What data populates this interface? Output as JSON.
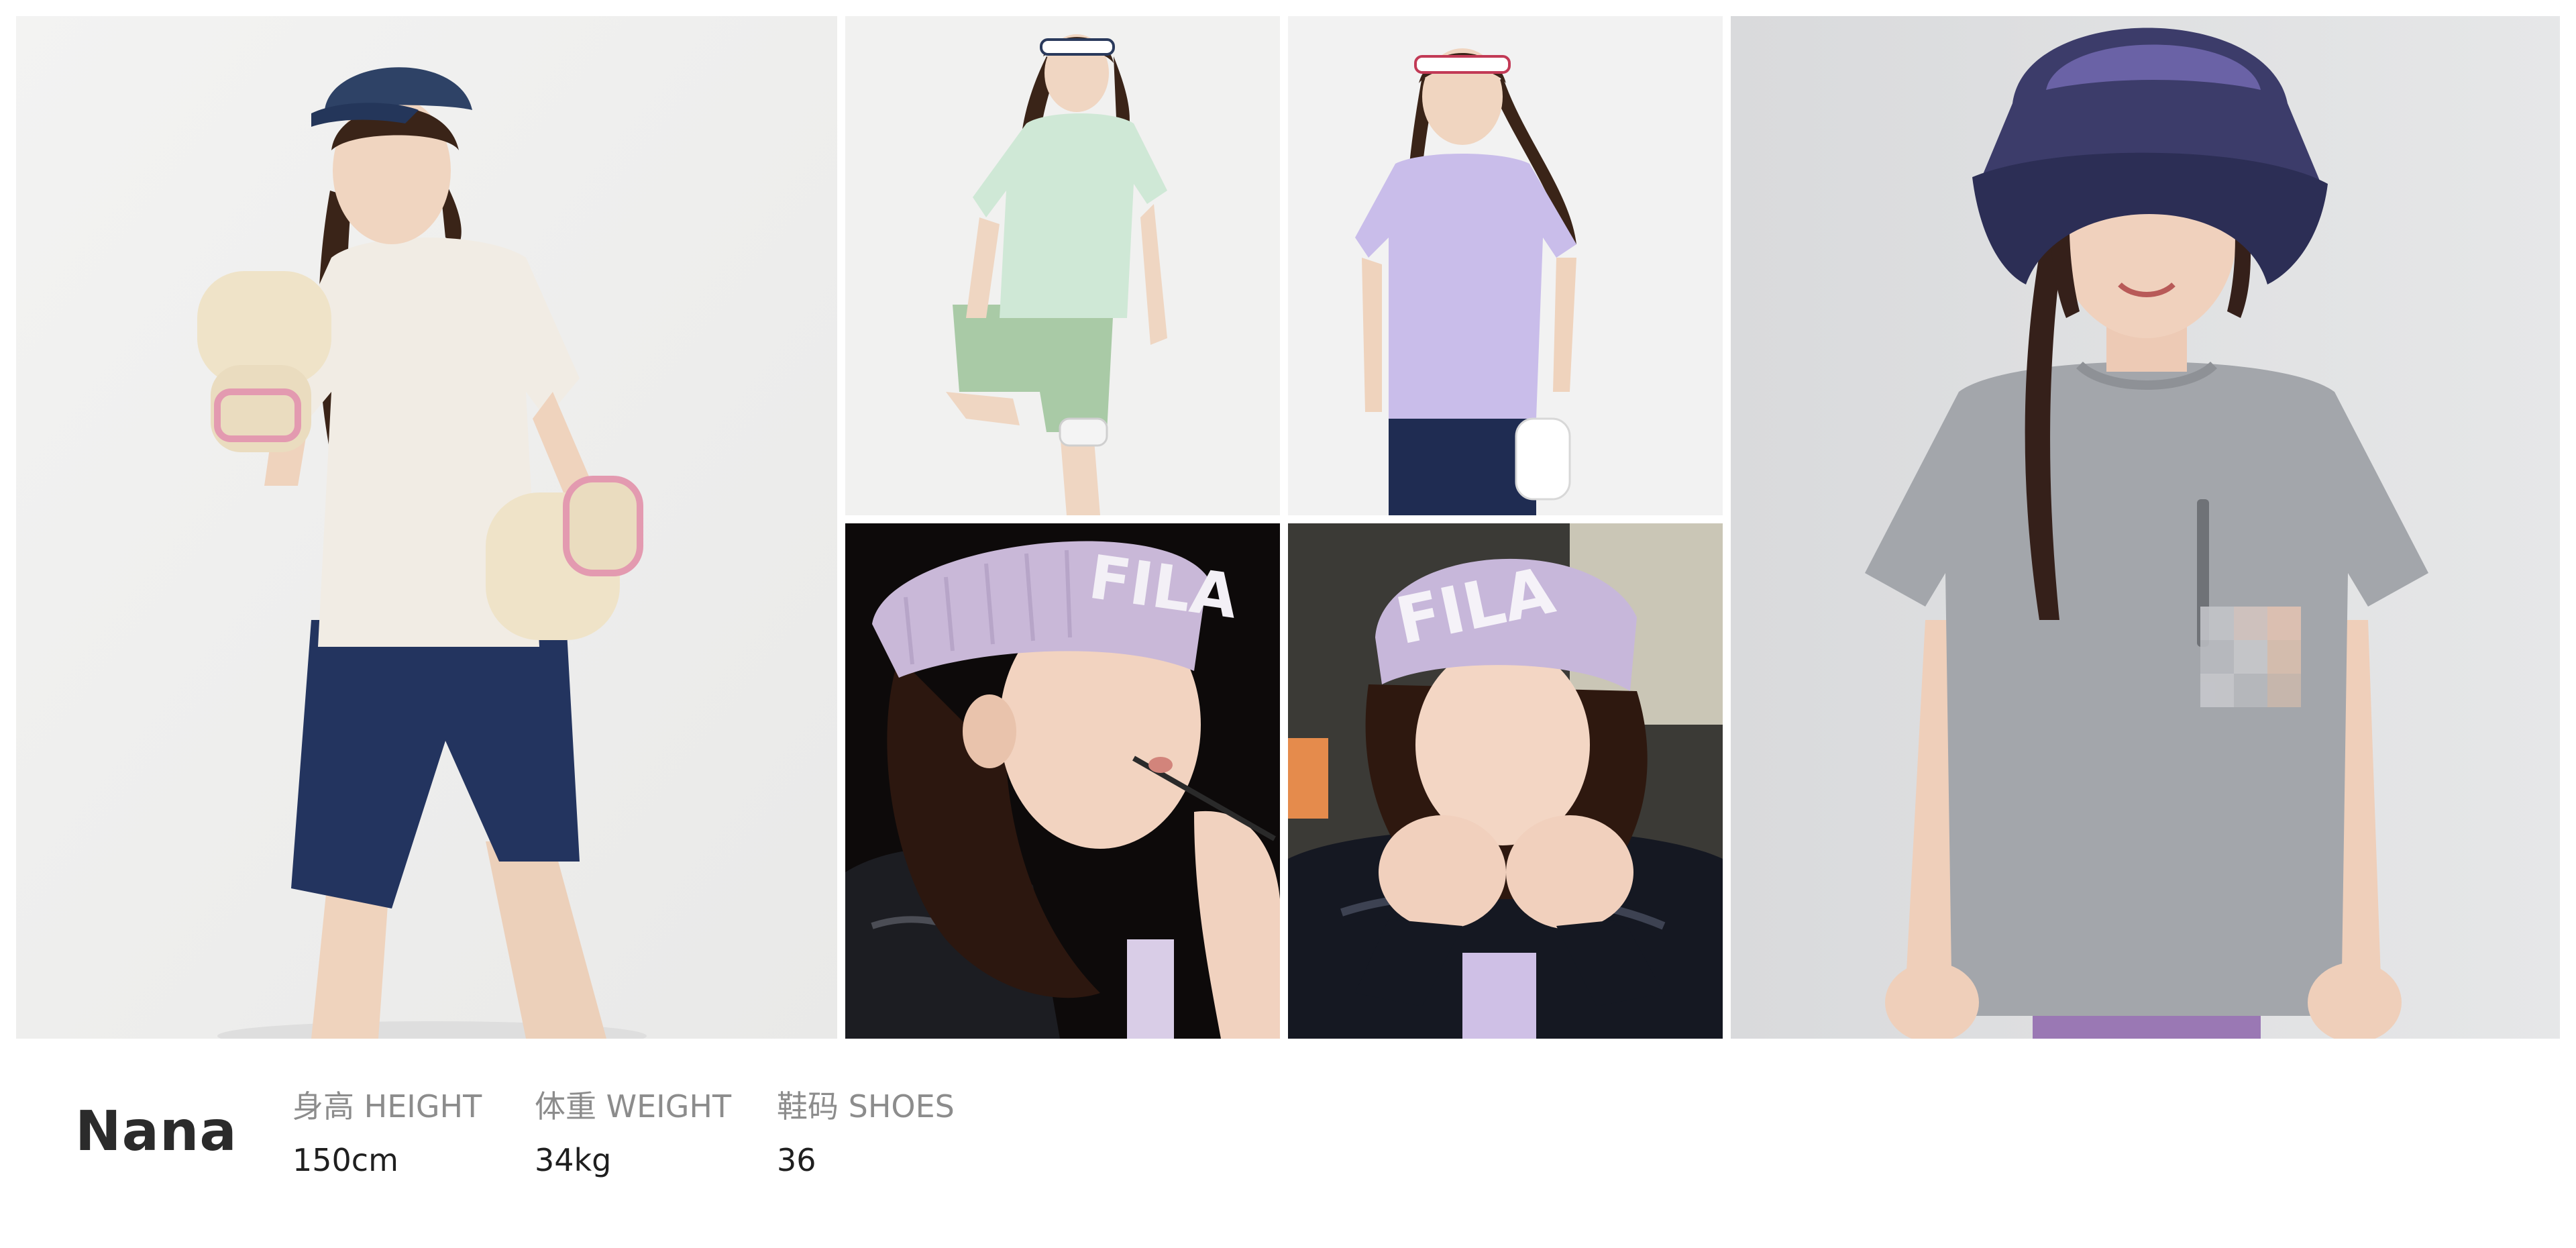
{
  "gallery": {
    "photos": [
      {
        "subject": "model-boxing-gloves-navy-cap"
      },
      {
        "subject": "model-mint-outfit-headband"
      },
      {
        "subject": "model-lavender-tee-headband"
      },
      {
        "subject": "model-fila-beanie-lipstick",
        "beanie_text": "FILA"
      },
      {
        "subject": "model-fila-beanie-fists",
        "beanie_text": "FILA"
      },
      {
        "subject": "model-gray-tee-bucket-hat"
      }
    ]
  },
  "model": {
    "name": "Nana",
    "stats": {
      "height": {
        "label": "身高 HEIGHT",
        "value": "150cm"
      },
      "weight": {
        "label": "体重 WEIGHT",
        "value": "34kg"
      },
      "shoes": {
        "label": "鞋码 SHOES",
        "value": "36"
      }
    }
  },
  "colors": {
    "name_text": "#2b2b2b",
    "label_text": "#8c8c8c",
    "value_text": "#1f1f1f",
    "background": "#ffffff"
  }
}
